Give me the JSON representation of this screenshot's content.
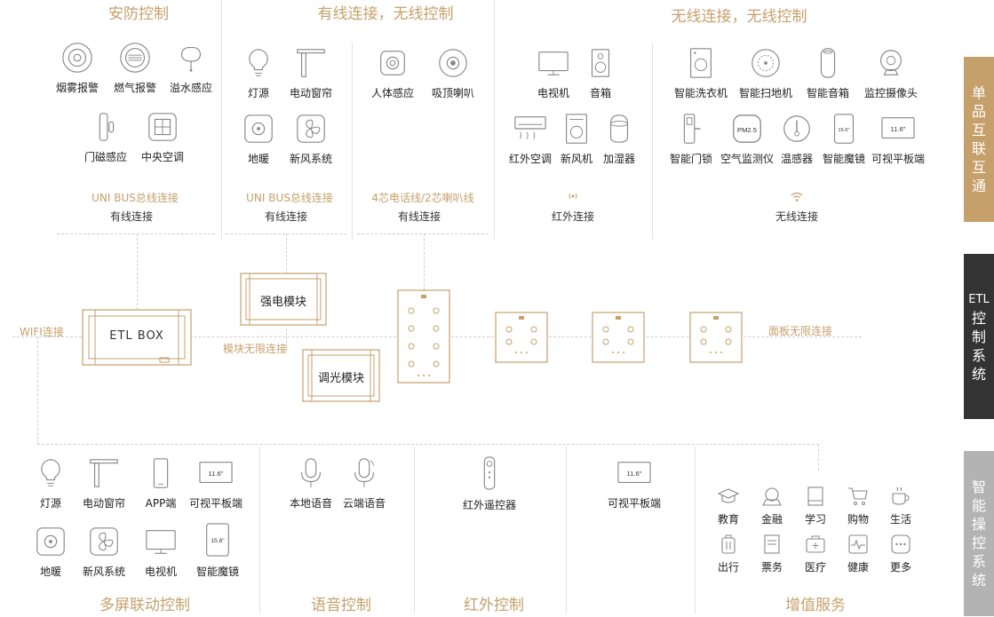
{
  "top_sections": {
    "security": {
      "title": "安防控制",
      "bus": "UNI BUS总线连接",
      "conn": "有线连接",
      "items": [
        "烟雾报警",
        "燃气报警",
        "溢水感应",
        "门磁感应",
        "中央空调"
      ]
    },
    "wired_a": {
      "title": "有线连接，无线控制",
      "bus": "UNI BUS总线连接",
      "conn": "有线连接",
      "items": [
        "灯源",
        "电动窗帘",
        "地暖",
        "新风系统"
      ]
    },
    "wired_b": {
      "bus": "4芯电话线/2芯喇叭线",
      "conn": "有线连接",
      "items": [
        "人体感应",
        "吸顶喇叭"
      ]
    },
    "wireless_title": "无线连接，无线控制",
    "ir": {
      "conn": "红外连接",
      "items": [
        "电视机",
        "音箱",
        "红外空调",
        "新风机",
        "加湿器"
      ]
    },
    "wifi": {
      "conn": "无线连接",
      "items": [
        "智能洗衣机",
        "智能扫地机",
        "智能音箱",
        "监控摄像头",
        "智能门锁",
        "空气监测仪",
        "温感器",
        "智能魔镜",
        "可视平板端"
      ]
    }
  },
  "middle": {
    "wifi_label": "WIFI连接",
    "etl_box": "ETL BOX",
    "strong_module": "强电模块",
    "dimmer_module": "调光模块",
    "module_link": "模块无限连接",
    "panel_link": "面板无限连接",
    "tablet_size": "11.6\"",
    "mirror_size": "15.6\"",
    "pm_label": "PM2.5"
  },
  "sidebar": {
    "s1": [
      "单",
      "品",
      "互",
      "联",
      "互",
      "通"
    ],
    "s2": [
      "ETL",
      "控",
      "制",
      "系",
      "统"
    ],
    "s3": [
      "智",
      "能",
      "操",
      "控",
      "系",
      "统"
    ],
    "colors": {
      "s1": "#c6a06b",
      "s2": "#333333",
      "s3": "#b3b3b3"
    }
  },
  "bottom": {
    "multi": {
      "title": "多屏联动控制",
      "items": [
        "灯源",
        "电动窗帘",
        "APP端",
        "可视平板端",
        "地暖",
        "新风系统",
        "电视机",
        "智能魔镜"
      ]
    },
    "voice": {
      "title": "语音控制",
      "items": [
        "本地语音",
        "云端语音"
      ]
    },
    "ir": {
      "title": "红外控制",
      "items": [
        "红外遥控器"
      ]
    },
    "tablet": {
      "items": [
        "可视平板端"
      ]
    },
    "svc": {
      "title": "增值服务",
      "items": [
        "教育",
        "金融",
        "学习",
        "购物",
        "生活",
        "出行",
        "票务",
        "医疗",
        "健康",
        "更多"
      ]
    }
  },
  "colors": {
    "accent": "#c6a06b",
    "text": "#222222",
    "line": "#cfcfcf"
  }
}
